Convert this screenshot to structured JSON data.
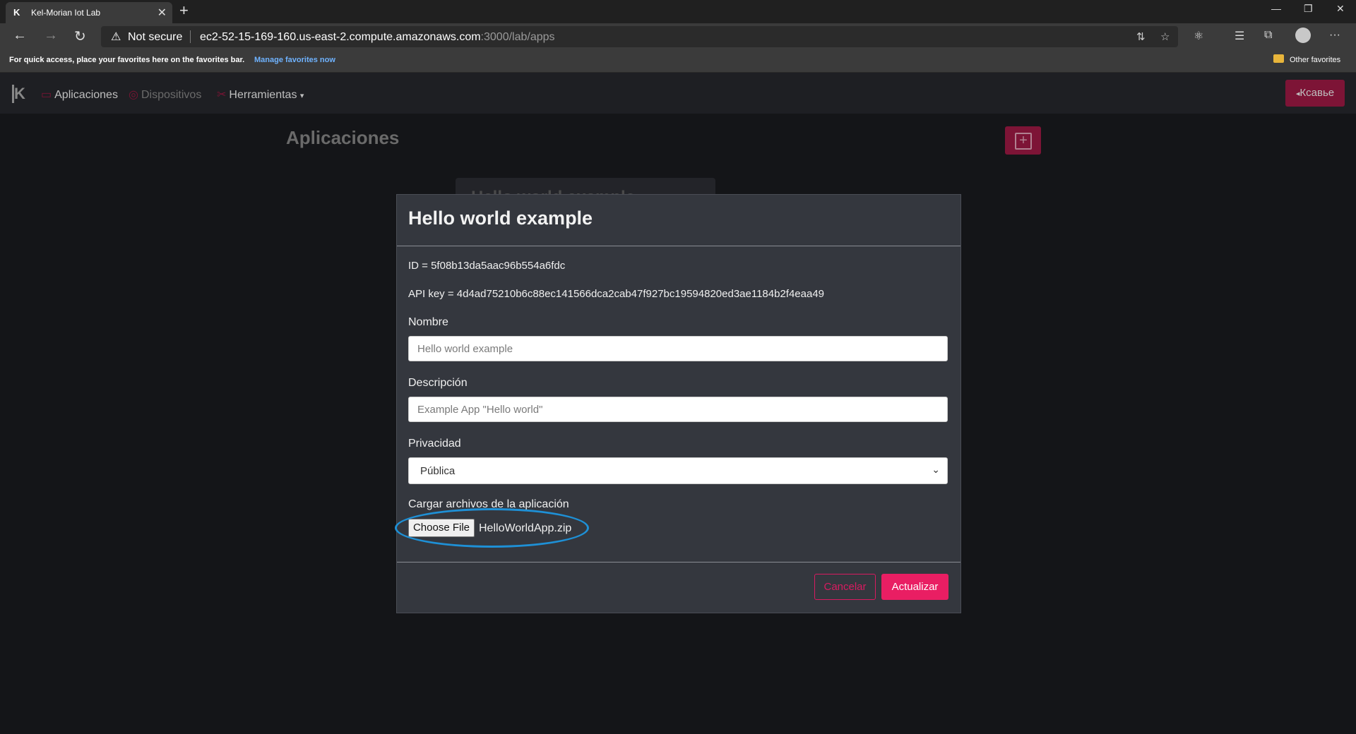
{
  "browser": {
    "tab_title": "Kel-Morian Iot Lab",
    "not_secure": "Not secure",
    "url_host": "ec2-52-15-169-160.us-east-2.compute.amazonaws.com",
    "url_path": ":3000/lab/apps",
    "favorites_hint": "For quick access, place your favorites here on the favorites bar.",
    "manage_favorites": "Manage favorites now",
    "other_favorites": "Other favorites"
  },
  "nav": {
    "apps": "Aplicaciones",
    "devices": "Dispositivos",
    "tools": "Herramientas",
    "logout": "Ксавье"
  },
  "page": {
    "title": "Aplicaciones",
    "bg_card_title": "Hello world example"
  },
  "modal": {
    "title": "Hello world example",
    "id_line": "ID = 5f08b13da5aac96b554a6fdc",
    "apikey_line": "API key = 4d4ad75210b6c88ec141566dca2cab47f927bc19594820ed3ae1184b2f4eaa49",
    "name_label": "Nombre",
    "name_placeholder": "Hello world example",
    "desc_label": "Descripción",
    "desc_placeholder": "Example App \"Hello world\"",
    "privacy_label": "Privacidad",
    "privacy_value": "Pública",
    "upload_label": "Cargar archivos de la aplicación",
    "choose_file": "Choose File",
    "file_name": "HelloWorldApp.zip",
    "cancel": "Cancelar",
    "update": "Actualizar"
  },
  "colors": {
    "accent": "#e91e63",
    "highlight": "#1e90d6"
  }
}
